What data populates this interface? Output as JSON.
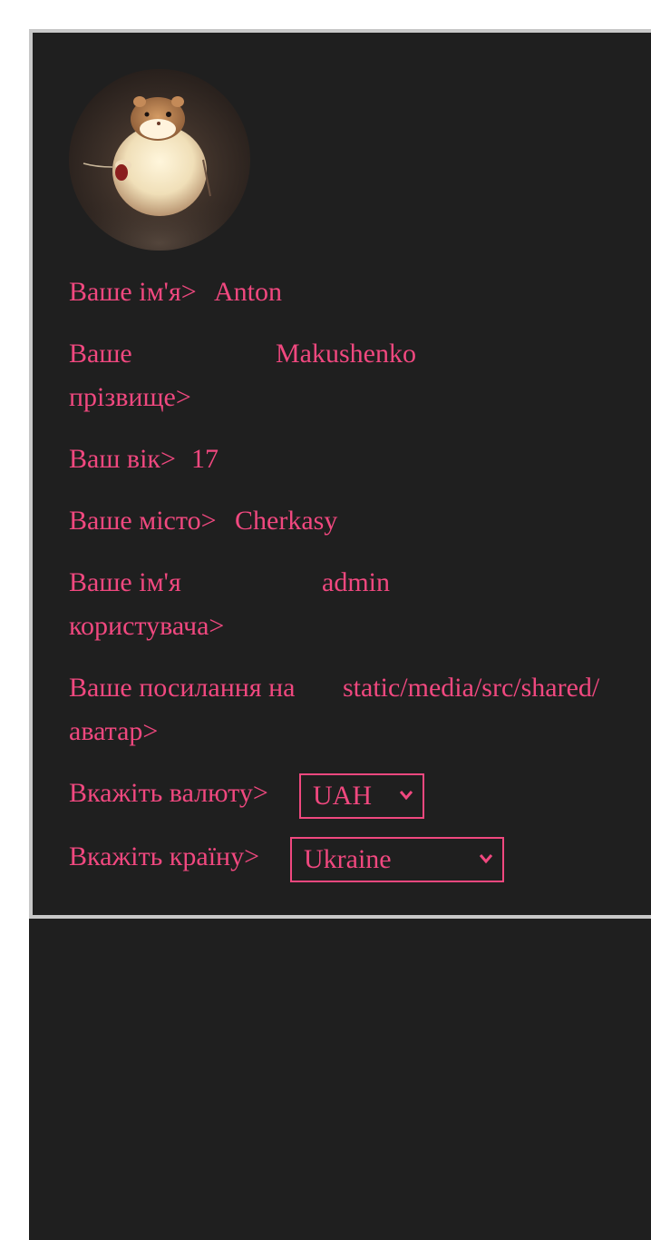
{
  "profile": {
    "avatar_icon": "hamster-avatar",
    "fields": {
      "name": {
        "label": "Ваше ім'я>",
        "value": "Anton"
      },
      "surname": {
        "label": "Ваше прізвище>",
        "value": "Makushenko"
      },
      "age": {
        "label": "Ваш вік>",
        "value": "17"
      },
      "city": {
        "label": "Ваше місто>",
        "value": "Cherkasy"
      },
      "username": {
        "label": "Ваше ім'я користувача>",
        "value": "admin"
      },
      "avatar_link": {
        "label": "Ваше посилання на аватар>",
        "value": "static/media/src/shared/"
      }
    },
    "currency": {
      "label": "Вкажіть валюту>",
      "selected": "UAH"
    },
    "country": {
      "label": "Вкажіть країну>",
      "selected": "Ukraine"
    }
  },
  "colors": {
    "background": "#1f1f1f",
    "accent": "#f0487f",
    "border": "#c8c8c8"
  }
}
